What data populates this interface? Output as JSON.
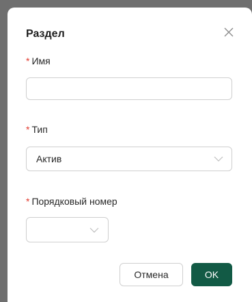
{
  "dialog": {
    "title": "Раздел",
    "required_mark": "*",
    "fields": {
      "name": {
        "label": "Имя",
        "value": "",
        "placeholder": ""
      },
      "type": {
        "label": "Тип",
        "value": "Актив"
      },
      "order": {
        "label": "Порядковый номер",
        "value": ""
      }
    },
    "buttons": {
      "cancel": "Отмена",
      "ok": "OK"
    },
    "icons": {
      "close": "close-icon",
      "chevron": "chevron-down-icon"
    },
    "colors": {
      "primary": "#125a45",
      "required": "#e23b30",
      "overlay": "#6f6f6f"
    }
  }
}
